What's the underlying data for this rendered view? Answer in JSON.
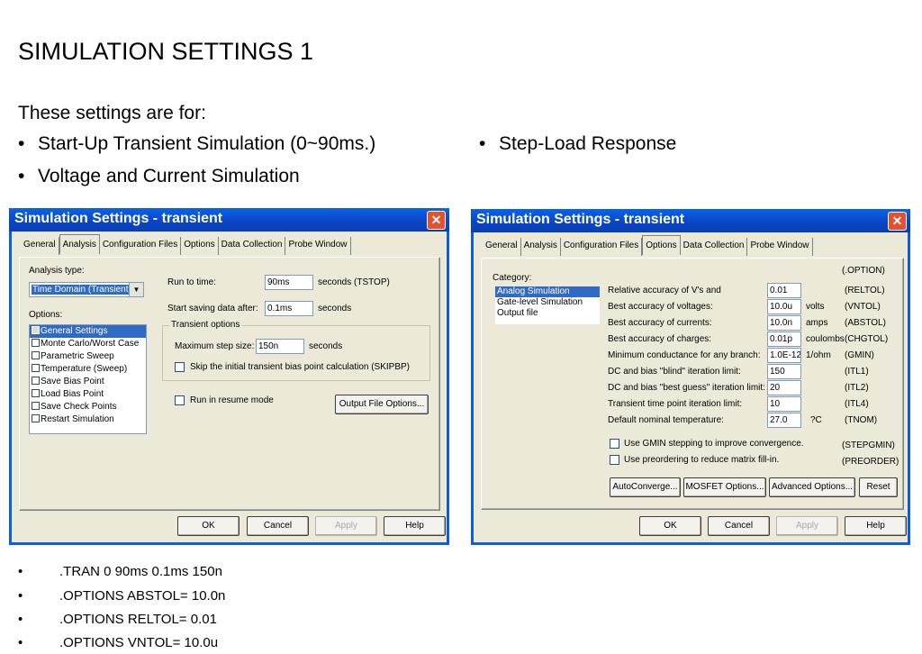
{
  "slide": {
    "title": "SIMULATION SETTINGS 1",
    "intro": "These settings are for:",
    "bullets": [
      "Start-Up Transient Simulation (0~90ms.)",
      "Voltage and Current Simulation",
      "Step-Load Response"
    ],
    "bullet_char": "•",
    "footnotes": [
      ".TRAN  0 90ms 0.1ms 150n",
      ".OPTIONS ABSTOL= 10.0n",
      ".OPTIONS RELTOL= 0.01",
      ".OPTIONS VNTOL= 10.0u"
    ]
  },
  "colors": {
    "titlebar": "#0b4ccb",
    "dialog_bg": "#ece9d8",
    "selection": "#316ac5",
    "close_button": "#e4512e"
  },
  "dialog_left": {
    "title": "Simulation Settings - transient",
    "close_icon": "✕",
    "tabs": [
      "General",
      "Analysis",
      "Configuration Files",
      "Options",
      "Data Collection",
      "Probe Window"
    ],
    "active_tab": "Analysis",
    "analysis_type_label": "Analysis type:",
    "analysis_type_value": "Time Domain (Transient)",
    "dropdown_arrow": "▼",
    "options_label": "Options:",
    "options": [
      "General Settings",
      "Monte Carlo/Worst Case",
      "Parametric Sweep",
      "Temperature (Sweep)",
      "Save Bias Point",
      "Load Bias Point",
      "Save Check Points",
      "Restart Simulation"
    ],
    "selected_option": "General Settings",
    "run_to_label": "Run to time:",
    "run_to_value": "90ms",
    "run_to_unit": "seconds  (TSTOP)",
    "start_saving_label": "Start saving data after:",
    "start_saving_value": "0.1ms",
    "start_saving_unit": "seconds",
    "transient_group": "Transient options",
    "max_step_label": "Maximum step size:",
    "max_step_value": "150n",
    "max_step_unit": "seconds",
    "skip_bias_label": "Skip the initial transient bias point calculation  (SKIPBP)",
    "resume_label": "Run in resume mode",
    "output_options_button": "Output File Options...",
    "ok": "OK",
    "cancel": "Cancel",
    "apply": "Apply",
    "help": "Help"
  },
  "dialog_right": {
    "title": "Simulation Settings - transient",
    "close_icon": "✕",
    "tabs": [
      "General",
      "Analysis",
      "Configuration Files",
      "Options",
      "Data Collection",
      "Probe Window"
    ],
    "active_tab": "Options",
    "category_label": "Category:",
    "categories": [
      "Analog Simulation",
      "Gate-level Simulation",
      "Output file"
    ],
    "selected_category": "Analog Simulation",
    "option_header": "(.OPTION)",
    "rows": [
      {
        "label": "Relative accuracy of V's and",
        "value": "0.01",
        "unit": "",
        "param": "(RELTOL)"
      },
      {
        "label": "Best accuracy of voltages:",
        "value": "10.0u",
        "unit": "volts",
        "param": "(VNTOL)"
      },
      {
        "label": "Best accuracy of currents:",
        "value": "10.0n",
        "unit": "amps",
        "param": "(ABSTOL)"
      },
      {
        "label": "Best accuracy of charges:",
        "value": "0.01p",
        "unit": "coulombs",
        "param": "(CHGTOL)"
      },
      {
        "label": "Minimum conductance for any branch:",
        "value": "1.0E-12",
        "unit": "1/ohm",
        "param": "(GMIN)"
      },
      {
        "label": "DC and bias \"blind\" iteration limit:",
        "value": "150",
        "unit": "",
        "param": "(ITL1)"
      },
      {
        "label": "DC and bias \"best guess\" iteration limit:",
        "value": "20",
        "unit": "",
        "param": "(ITL2)"
      },
      {
        "label": "Transient time point iteration limit:",
        "value": "10",
        "unit": "",
        "param": "(ITL4)"
      },
      {
        "label": "Default nominal temperature:",
        "value": "27.0",
        "unit": "?C",
        "param": "(TNOM)"
      }
    ],
    "gmin_label": "Use GMIN stepping to improve convergence.",
    "gmin_param": "(STEPGMIN)",
    "preorder_label": "Use preordering to reduce matrix fill-in.",
    "preorder_param": "(PREORDER)",
    "autoconverge": "AutoConverge...",
    "mosfet": "MOSFET Options...",
    "advanced": "Advanced Options...",
    "reset": "Reset",
    "ok": "OK",
    "cancel": "Cancel",
    "apply": "Apply",
    "help": "Help"
  }
}
